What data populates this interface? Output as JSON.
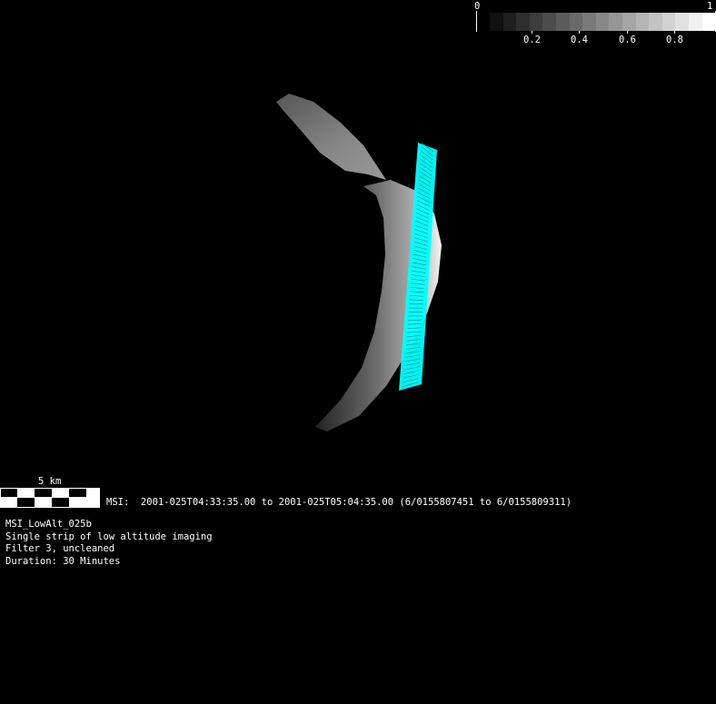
{
  "colorbar": {
    "min_label": "0",
    "max_label": "1",
    "tick_labels": [
      "0.2",
      "0.4",
      "0.6",
      "0.8"
    ],
    "steps": 17
  },
  "scale_bar": {
    "label": "5 km"
  },
  "observation": {
    "time_range": "MSI:  2001-025T04:33:35.00 to 2001-025T05:04:35.00 (6/0155807451 to 6/0155809311)"
  },
  "info": {
    "name": "MSI_LowAlt_025b",
    "description": "Single strip of low altitude imaging",
    "filter": "Filter 3, uncleaned",
    "duration": "Duration: 30 Minutes"
  },
  "colors": {
    "footprint": "#00ffff",
    "background": "#000000"
  }
}
